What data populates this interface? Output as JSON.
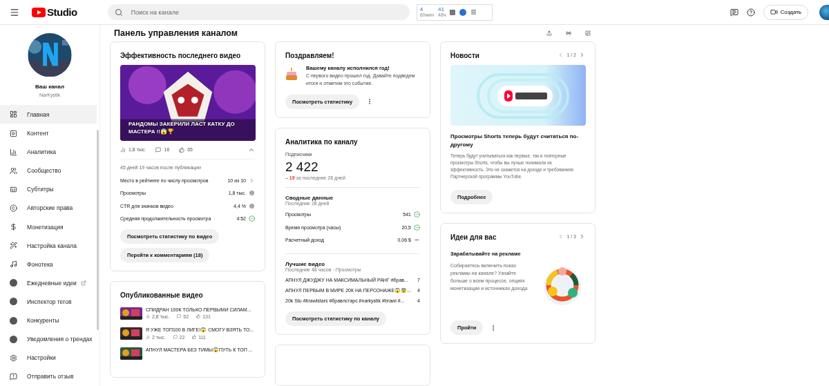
{
  "header": {
    "logo_text": "Studio",
    "search_placeholder": "Поиск на канале",
    "extension": [
      {
        "value": "4",
        "label": "60мин"
      },
      {
        "value": "41",
        "label": "48ч"
      }
    ],
    "create_label": "Создать"
  },
  "sidebar": {
    "channel_label": "Ваш канал",
    "channel_name": "NarKystik",
    "items": [
      {
        "label": "Главная",
        "kind": "nav",
        "selected": true,
        "external": false
      },
      {
        "label": "Контент",
        "kind": "nav",
        "selected": false,
        "external": false
      },
      {
        "label": "Аналитика",
        "kind": "nav",
        "selected": false,
        "external": false
      },
      {
        "label": "Сообщество",
        "kind": "nav",
        "selected": false,
        "external": false
      },
      {
        "label": "Субтитры",
        "kind": "nav",
        "selected": false,
        "external": false
      },
      {
        "label": "Авторские права",
        "kind": "nav",
        "selected": false,
        "external": false
      },
      {
        "label": "Монетизация",
        "kind": "nav",
        "selected": false,
        "external": false
      },
      {
        "label": "Настройка канала",
        "kind": "nav",
        "selected": false,
        "external": false
      },
      {
        "label": "Фонотека",
        "kind": "nav",
        "selected": false,
        "external": false
      },
      {
        "label": "Ежедневные идеи",
        "kind": "extension",
        "selected": false,
        "external": true
      },
      {
        "label": "Инспектор тегов",
        "kind": "extension",
        "selected": false,
        "external": false
      },
      {
        "label": "Конкуренты",
        "kind": "extension",
        "selected": false,
        "external": false
      },
      {
        "label": "Уведомления о трендах",
        "kind": "extension",
        "selected": false,
        "external": false
      },
      {
        "label": "Настройки",
        "kind": "nav",
        "selected": false,
        "external": false
      },
      {
        "label": "Отправить отзыв",
        "kind": "nav",
        "selected": false,
        "external": false
      }
    ]
  },
  "page_title": "Панель управления каналом",
  "latest_video": {
    "title": "Эффективность последнего видео",
    "video_title": "РАНДОМЫ ЗАКЕРИЛИ ЛАСТ КАТКУ ДО МАСТЕРА !!😱🏆",
    "views": "1,8 тыс.",
    "comments": "18",
    "likes": "65",
    "expanded": true,
    "since": "45 дней 19 часов после публикации",
    "metrics": [
      {
        "label": "Место в рейтинге по числу просмотров",
        "value": "10 из 10",
        "kind": "rank"
      },
      {
        "label": "Просмотры",
        "value": "1,8 тыс.",
        "kind": "neutral"
      },
      {
        "label": "CTR для значков видео",
        "value": "4,4 %",
        "kind": "neutral"
      },
      {
        "label": "Средняя продолжительность просмотра",
        "value": "4:52",
        "kind": "good"
      }
    ],
    "buttons": [
      "Посмотреть статистику по видео",
      "Перейти к комментариям (18)"
    ]
  },
  "published": {
    "title": "Опубликованные видео",
    "videos": [
      {
        "title": "СПИДРАН 100К ТОЛЬКО ПЕРВЫМИ СИЛАМ...",
        "views": "2,8 тыс.",
        "comments": "52",
        "likes": "131"
      },
      {
        "title": "Я УЖЕ ТОП100 В ЛИГЕ!😱 СМОГУ ВЗЯТЬ ТО...",
        "views": "2 тыс.",
        "comments": "22",
        "likes": "111"
      },
      {
        "title": "АПНУЛ МАСТЕРА БЕЗ ТИМЫ😱ПУТЬ К ТОП ..."
      }
    ]
  },
  "congrats": {
    "title": "Поздравляем!",
    "heading": "Вашему каналу исполнился год!",
    "body": "С первого видео прошел год. Давайте подведем итоги и отметим это событие.",
    "button": "Посмотреть статистику"
  },
  "analytics": {
    "title": "Аналитика по каналу",
    "subscribers_label": "Подписчики",
    "subscribers": "2 422",
    "change": "– 19",
    "change_suffix": "за последние 28 дней",
    "summary_title": "Сводные данные",
    "summary_period": "Последние 28 дней",
    "summary": [
      {
        "label": "Просмотры",
        "value": "541",
        "kind": "good"
      },
      {
        "label": "Время просмотра (часы)",
        "value": "20,5",
        "kind": "good"
      },
      {
        "label": "Расчетный доход",
        "value": "0,06 $",
        "kind": "none"
      }
    ],
    "top_title": "Лучшие видео",
    "top_period": "Последние 48 часов · Просмотры",
    "top_videos": [
      {
        "title": "АПНУЛ ДЖУДЖУ НА МАКСИМАЛЬНЫЙ РАНГ #брав...",
        "views": "7"
      },
      {
        "title": "АПНУЛ ПЕРВЫМ В МИРЕ 20К НА ПЕРСОНАЖЕ😱😨...",
        "views": "4"
      },
      {
        "title": "20k Stu #brawlstars #бравлстарс #narkystik #brawl #...",
        "views": "4"
      }
    ],
    "button": "Посмотреть статистику по каналу"
  },
  "news": {
    "title": "Новости",
    "pager": "1 / 2",
    "headline": "Просмотры Shorts теперь будут считаться по-другому",
    "body": "Теперь будут учитываться как первые, так и повторные просмотры Shorts, чтобы вы лучше понимали их эффективность. Это не скажется на доходе и требованиях Партнерской программы YouTube.",
    "button": "Подробнее"
  },
  "ideas": {
    "title": "Идеи для вас",
    "pager": "1 / 3",
    "heading": "Зарабатывайте на рекламе",
    "body": "Собираетесь включить показ рекламы на канале? Узнайте больше о всем процессе, опциях монетизации и источниках дохода",
    "button": "Пройти"
  }
}
